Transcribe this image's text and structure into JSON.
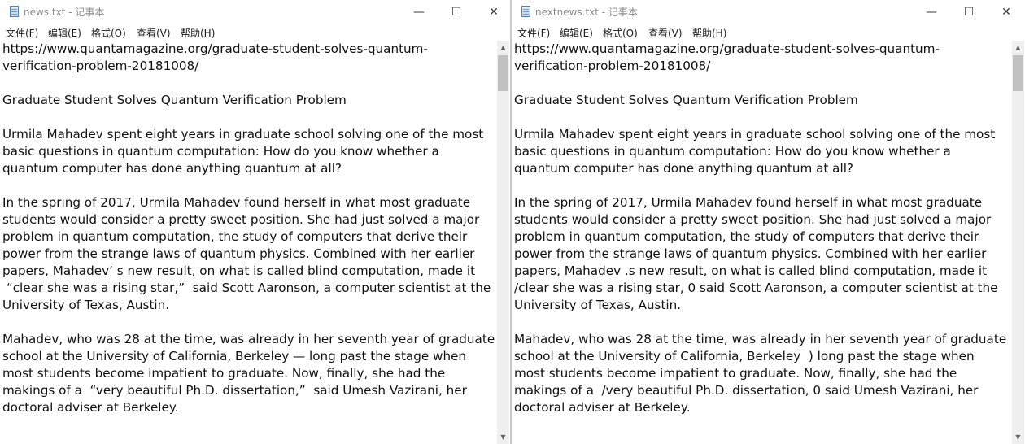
{
  "left": {
    "title": "news.txt - 记事本",
    "menu": [
      "文件(F)",
      "编辑(E)",
      "格式(O)",
      "查看(V)",
      "帮助(H)"
    ],
    "lines": [
      "https://www.quantamagazine.org/graduate-student-solves-quantum-",
      "verification-problem-20181008/",
      "",
      "Graduate Student Solves Quantum Verification Problem",
      "",
      "Urmila Mahadev spent eight years in graduate school solving one of the most",
      "basic questions in quantum computation: How do you know whether a",
      "quantum computer has done anything quantum at all?",
      "",
      "In the spring of 2017, Urmila Mahadev found herself in what most graduate",
      "students would consider a pretty sweet position. She had just solved a major",
      "problem in quantum computation, the study of computers that derive their",
      "power from the strange laws of quantum physics. Combined with her earlier",
      "papers, Mahadev’ s new result, on what is called blind computation, made it",
      " “clear she was a rising star,”  said Scott Aaronson, a computer scientist at the",
      "University of Texas, Austin.",
      "",
      "Mahadev, who was 28 at the time, was already in her seventh year of graduate",
      "school at the University of California, Berkeley — long past the stage when",
      "most students become impatient to graduate. Now, finally, she had the",
      "makings of a  “very beautiful Ph.D. dissertation,”  said Umesh Vazirani, her",
      "doctoral adviser at Berkeley."
    ]
  },
  "right": {
    "title": "nextnews.txt - 记事本",
    "menu": [
      "文件(F)",
      "编辑(E)",
      "格式(O)",
      "查看(V)",
      "帮助(H)"
    ],
    "lines": [
      "https://www.quantamagazine.org/graduate-student-solves-quantum-",
      "verification-problem-20181008/",
      "",
      "Graduate Student Solves Quantum Verification Problem",
      "",
      "Urmila Mahadev spent eight years in graduate school solving one of the most",
      "basic questions in quantum computation: How do you know whether a",
      "quantum computer has done anything quantum at all?",
      "",
      "In the spring of 2017, Urmila Mahadev found herself in what most graduate",
      "students would consider a pretty sweet position. She had just solved a major",
      "problem in quantum computation, the study of computers that derive their",
      "power from the strange laws of quantum physics. Combined with her earlier",
      "papers, Mahadev .s new result, on what is called blind computation, made it",
      "/clear she was a rising star, 0 said Scott Aaronson, a computer scientist at the",
      "University of Texas, Austin.",
      "",
      "Mahadev, who was 28 at the time, was already in her seventh year of graduate",
      "school at the University of California, Berkeley  ) long past the stage when",
      "most students become impatient to graduate. Now, finally, she had the",
      "makings of a  /very beautiful Ph.D. dissertation, 0 said Umesh Vazirani, her",
      "doctoral adviser at Berkeley."
    ]
  },
  "icons": {
    "minimize": "—",
    "maximize": "☐",
    "close": "✕",
    "scroll_up": "▲",
    "scroll_down": "▼"
  }
}
